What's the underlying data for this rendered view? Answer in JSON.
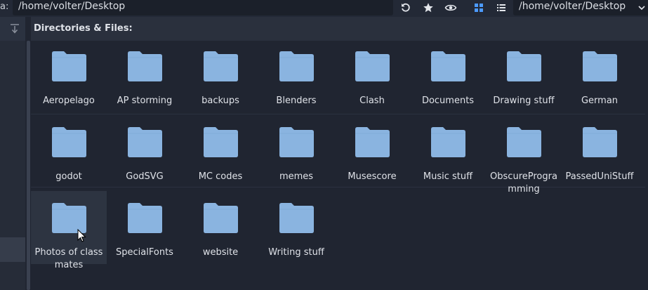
{
  "toolbar": {
    "path_label": "a:",
    "path_value": "/home/volter/Desktop",
    "icons": [
      "refresh-icon",
      "favorite-star-icon",
      "show-hidden-eye-icon",
      "grid-view-icon",
      "list-view-icon"
    ],
    "dir_select_value": "/home/volter/Desktop"
  },
  "main": {
    "title": "Directories & Files:",
    "items": [
      {
        "label": "Aeropelago"
      },
      {
        "label": "AP storming"
      },
      {
        "label": "backups"
      },
      {
        "label": "Blenders"
      },
      {
        "label": "Clash"
      },
      {
        "label": "Documents"
      },
      {
        "label": "Drawing stuff"
      },
      {
        "label": "German"
      },
      {
        "label": "godot"
      },
      {
        "label": "GodSVG"
      },
      {
        "label": "MC codes"
      },
      {
        "label": "memes"
      },
      {
        "label": "Musescore"
      },
      {
        "label": "Music stuff"
      },
      {
        "label": "ObscureProgramming"
      },
      {
        "label": "PassedUniStuff"
      },
      {
        "label": "Photos of classmates"
      },
      {
        "label": "SpecialFonts"
      },
      {
        "label": "website"
      },
      {
        "label": "Writing stuff"
      }
    ]
  },
  "colors": {
    "background": "#202531",
    "folder": "#8ab4e0",
    "accent": "#4c9aff"
  }
}
